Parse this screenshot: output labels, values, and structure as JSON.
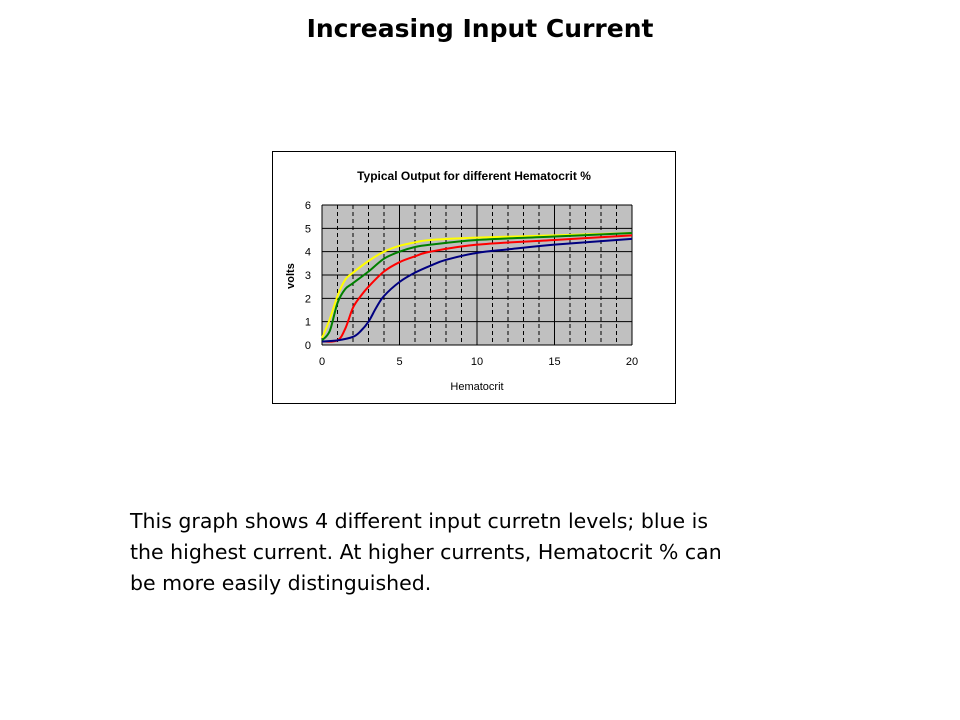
{
  "slide": {
    "title": "Increasing Input Current",
    "caption_lines": [
      "This graph shows 4 different input curretn levels; blue is",
      "the highest current. At higher currents, Hematocrit % can",
      "be more easily distinguished."
    ]
  },
  "chart_data": {
    "type": "line",
    "title": "Typical Output for different Hematocrit %",
    "xlabel": "Hematocrit",
    "ylabel": "volts",
    "xlim": [
      0,
      20
    ],
    "ylim": [
      0,
      6
    ],
    "xticks": [
      0,
      5,
      10,
      15,
      20
    ],
    "yticks": [
      0,
      1,
      2,
      3,
      4,
      5,
      6
    ],
    "x_minor_gridlines": [
      1,
      2,
      3,
      4,
      6,
      7,
      8,
      9,
      11,
      12,
      13,
      14,
      16,
      17,
      18,
      19
    ],
    "grid": true,
    "legend": "none",
    "plot_background": "#c0c0c0",
    "series": [
      {
        "name": "yellow",
        "color": "#ffff00",
        "x": [
          0,
          0.5,
          1,
          1.5,
          2,
          3,
          4,
          5,
          6,
          7,
          10,
          15,
          20
        ],
        "y": [
          0.3,
          1.1,
          2.1,
          2.8,
          3.1,
          3.6,
          4.0,
          4.25,
          4.4,
          4.5,
          4.6,
          4.7,
          4.8
        ]
      },
      {
        "name": "green",
        "color": "#008000",
        "x": [
          0,
          0.5,
          1,
          1.5,
          2,
          3,
          4,
          5,
          6,
          7,
          10,
          15,
          20
        ],
        "y": [
          0.2,
          0.6,
          1.8,
          2.4,
          2.65,
          3.15,
          3.7,
          4.0,
          4.2,
          4.3,
          4.5,
          4.65,
          4.8
        ]
      },
      {
        "name": "red",
        "color": "#ff0000",
        "x": [
          0,
          1,
          1.5,
          2,
          2.5,
          3,
          4,
          5,
          6,
          7,
          10,
          15,
          20
        ],
        "y": [
          0.15,
          0.2,
          0.7,
          1.6,
          2.1,
          2.5,
          3.15,
          3.55,
          3.8,
          4.0,
          4.3,
          4.5,
          4.7
        ]
      },
      {
        "name": "blue",
        "color": "#000080",
        "x": [
          0,
          1,
          2,
          2.5,
          3,
          3.5,
          4,
          5,
          6,
          7,
          8,
          10,
          12,
          15,
          20
        ],
        "y": [
          0.15,
          0.2,
          0.35,
          0.6,
          1.0,
          1.6,
          2.1,
          2.7,
          3.1,
          3.4,
          3.65,
          3.95,
          4.1,
          4.3,
          4.55
        ]
      }
    ]
  }
}
